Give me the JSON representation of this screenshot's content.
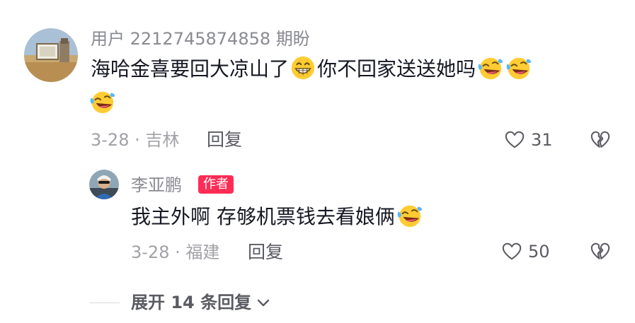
{
  "comment": {
    "username": "用户 2212745874858 期盼",
    "text_part1": "海哈金喜要回大凉山了",
    "text_part2": "你不回家送送她吗",
    "date_location": "3-28 · 吉林",
    "reply_label": "回复",
    "like_count": "31",
    "emojis": [
      "grin-emoji",
      "laugh-cry-emoji",
      "laugh-cry-emoji",
      "laugh-cry-emoji"
    ]
  },
  "reply": {
    "username": "李亚鹏",
    "badge": "作者",
    "text": "我主外啊 存够机票钱去看娘俩",
    "date_location": "3-28 · 福建",
    "reply_label": "回复",
    "like_count": "50",
    "emojis": [
      "laugh-cry-emoji"
    ]
  },
  "expand": {
    "label": "展开 14 条回复"
  },
  "colors": {
    "badge": "#fe2c55",
    "emoji_yellow": "#ffcc33",
    "secondary_text": "#8a8b91"
  }
}
